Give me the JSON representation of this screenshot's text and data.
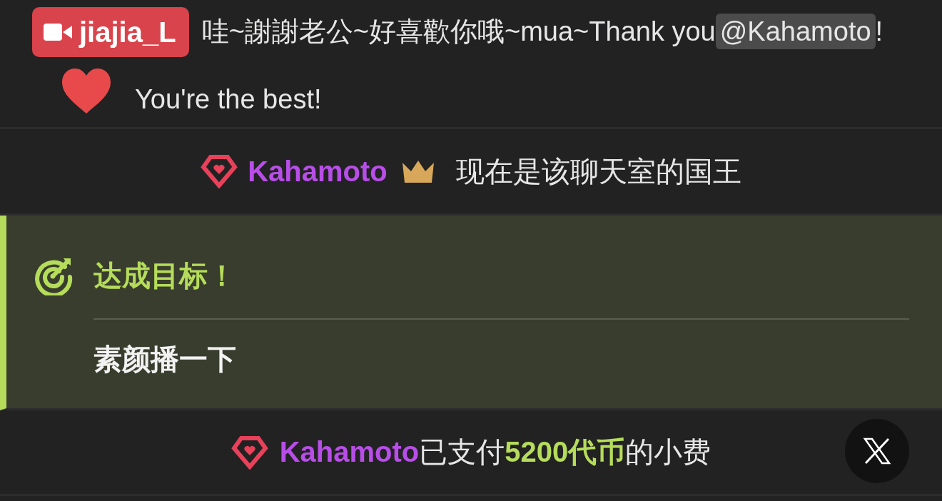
{
  "feed": [
    {
      "kind": "chat",
      "badge": {
        "username": "jiajia_L"
      },
      "parts": [
        {
          "kind": "text",
          "text": "哇~謝謝老公~好喜歡你哦~mua~Thank you"
        },
        {
          "kind": "mention",
          "text": "@Kahamoto"
        },
        {
          "kind": "text",
          "text": "!"
        },
        {
          "kind": "heart"
        },
        {
          "kind": "text",
          "text": "You're the best!"
        }
      ]
    },
    {
      "kind": "king",
      "user": "Kahamoto",
      "text": "现在是该聊天室的国王"
    },
    {
      "kind": "goal",
      "title": "达成目标！",
      "description": "素颜播一下"
    },
    {
      "kind": "tip",
      "user": "Kahamoto",
      "paid_text": "已支付",
      "amount": "5200代币",
      "suffix": "的小费"
    }
  ]
}
